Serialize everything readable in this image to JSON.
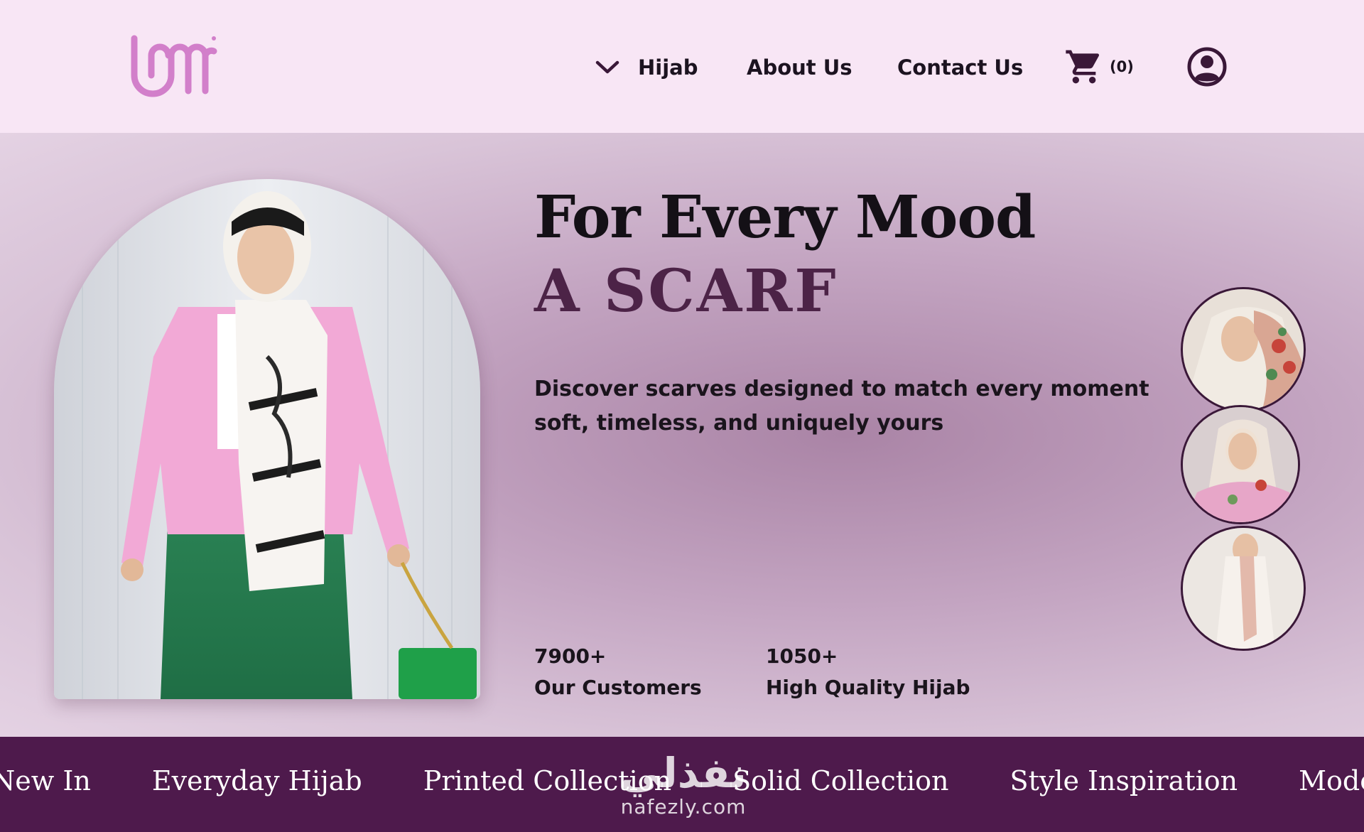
{
  "brand": {
    "logo_icon": "brand-logo",
    "accent": "#4e1a4c",
    "logo_color": "#d27fca"
  },
  "nav": {
    "hijab_label": "Hijab",
    "hijab_icon": "chevron-down-icon",
    "about_label": "About Us",
    "contact_label": "Contact Us",
    "cart_icon": "cart-icon",
    "cart_count": "(0)",
    "user_icon": "user-icon"
  },
  "hero": {
    "headline_line1": "For Every Mood",
    "headline_line2": "A  SCARF",
    "description": "Discover scarves designed to match every moment soft, timeless, and uniquely yours",
    "stats": [
      {
        "value": "7900+",
        "label": "Our Customers"
      },
      {
        "value": "1050+",
        "label": "High Quality Hijab"
      }
    ]
  },
  "categories": [
    "New In",
    "Everyday Hijab",
    "Printed Collection",
    "Solid Collection",
    "Style Inspiration",
    "Modest Hijab"
  ],
  "watermark": {
    "arabic": "نفذلي",
    "english": "nafezly.com"
  }
}
